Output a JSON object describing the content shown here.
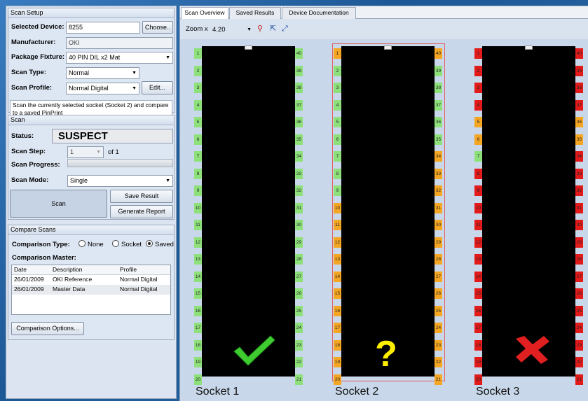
{
  "scan_setup": {
    "title": "Scan Setup",
    "selected_device_label": "Selected Device:",
    "selected_device": "8255",
    "choose_button": "Choose..",
    "manufacturer_label": "Manufacturer:",
    "manufacturer": "OKI",
    "package_fixture_label": "Package Fixture:",
    "package_fixture": "40 PIN DIL x2 Mat",
    "scan_type_label": "Scan Type:",
    "scan_type": "Normal",
    "scan_profile_label": "Scan Profile:",
    "scan_profile": "Normal Digital",
    "edit_button": "Edit...",
    "description": "Scan the currently selected socket (Socket 2) and compare to a saved PinPrint"
  },
  "scan": {
    "title": "Scan",
    "status_label": "Status:",
    "status": "SUSPECT",
    "scan_step_label": "Scan Step:",
    "scan_step": "1",
    "scan_step_of": "of 1",
    "scan_progress_label": "Scan Progress:",
    "scan_progress": 0,
    "scan_mode_label": "Scan Mode:",
    "scan_mode": "Single",
    "scan_button": "Scan",
    "save_result_button": "Save Result",
    "generate_report_button": "Generate Report"
  },
  "compare": {
    "title": "Compare Scans",
    "comparison_type_label": "Comparison Type:",
    "options": [
      "None",
      "Socket",
      "Saved"
    ],
    "selected": "Saved",
    "master_label": "Comparison Master:",
    "columns": [
      "Date",
      "Description",
      "Profile"
    ],
    "rows": [
      [
        "26/01/2009",
        "OKI Reference",
        "Normal Digital"
      ],
      [
        "26/01/2009",
        "Master Data",
        "Normal Digital"
      ]
    ],
    "options_button": "Comparison Options..."
  },
  "tabs": [
    "Scan Overview",
    "Saved Results",
    "Device Documentation"
  ],
  "active_tab": "Scan Overview",
  "toolbar": {
    "zoom_label": "Zoom x",
    "zoom_value": "4.20",
    "icons": [
      "zoom-in-icon",
      "zoom-fit-icon",
      "zoom-select-icon"
    ]
  },
  "colors": {
    "pin_pass": "#8ee07a",
    "pin_suspect": "#f5a623",
    "pin_fail": "#e21a1a",
    "check": "#3fcc30",
    "question": "#ffee00",
    "cross": "#e02020"
  },
  "sockets": [
    {
      "label": "Socket 1",
      "result_icon": "checkmark-icon",
      "left_pins": [
        "1",
        "2",
        "3",
        "4",
        "5",
        "6",
        "7",
        "8",
        "9",
        "10",
        "11",
        "12",
        "13",
        "14",
        "15",
        "16",
        "17",
        "18",
        "19",
        "20"
      ],
      "right_pins": [
        "40",
        "39",
        "38",
        "37",
        "36",
        "35",
        "34",
        "33",
        "32",
        "31",
        "30",
        "29",
        "28",
        "27",
        "26",
        "25",
        "24",
        "23",
        "22",
        "21"
      ],
      "left_status": [
        "p",
        "p",
        "p",
        "p",
        "p",
        "p",
        "p",
        "p",
        "p",
        "p",
        "p",
        "p",
        "p",
        "p",
        "p",
        "p",
        "p",
        "p",
        "p",
        "p"
      ],
      "right_status": [
        "p",
        "p",
        "p",
        "p",
        "p",
        "p",
        "p",
        "p",
        "p",
        "p",
        "p",
        "p",
        "p",
        "p",
        "p",
        "p",
        "p",
        "p",
        "p",
        "p"
      ]
    },
    {
      "label": "Socket 2",
      "result_icon": "question-mark-icon",
      "left_pins": [
        "1",
        "2",
        "3",
        "4",
        "5",
        "6",
        "7",
        "8",
        "9",
        "10",
        "11",
        "12",
        "13",
        "14",
        "15",
        "16",
        "17",
        "18",
        "19",
        "20"
      ],
      "right_pins": [
        "40",
        "39",
        "38",
        "37",
        "36",
        "35",
        "34",
        "33",
        "32",
        "31",
        "30",
        "29",
        "28",
        "27",
        "26",
        "25",
        "24",
        "23",
        "22",
        "21"
      ],
      "left_status": [
        "s",
        "p",
        "p",
        "p",
        "p",
        "p",
        "p",
        "p",
        "p",
        "s",
        "s",
        "s",
        "s",
        "s",
        "s",
        "s",
        "s",
        "s",
        "s",
        "s"
      ],
      "right_status": [
        "s",
        "p",
        "p",
        "p",
        "p",
        "p",
        "s",
        "s",
        "s",
        "s",
        "s",
        "s",
        "s",
        "s",
        "s",
        "s",
        "s",
        "s",
        "s",
        "s"
      ]
    },
    {
      "label": "Socket 3",
      "result_icon": "cross-icon",
      "left_pins": [
        "1",
        "2",
        "3",
        "4",
        "5",
        "6",
        "7",
        "8",
        "9",
        "10",
        "11",
        "12",
        "13",
        "14",
        "15",
        "16",
        "17",
        "18",
        "19",
        "20"
      ],
      "right_pins": [
        "40",
        "39",
        "38",
        "37",
        "36",
        "35",
        "34",
        "33",
        "32",
        "31",
        "30",
        "29",
        "28",
        "27",
        "26",
        "25",
        "24",
        "23",
        "22",
        "21"
      ],
      "left_status": [
        "f",
        "f",
        "f",
        "f",
        "s",
        "s",
        "p",
        "f",
        "f",
        "f",
        "f",
        "f",
        "f",
        "f",
        "f",
        "f",
        "f",
        "f",
        "f",
        "f"
      ],
      "right_status": [
        "f",
        "f",
        "f",
        "f",
        "s",
        "s",
        "f",
        "f",
        "f",
        "f",
        "f",
        "f",
        "f",
        "f",
        "f",
        "f",
        "f",
        "f",
        "f",
        "f"
      ]
    }
  ]
}
